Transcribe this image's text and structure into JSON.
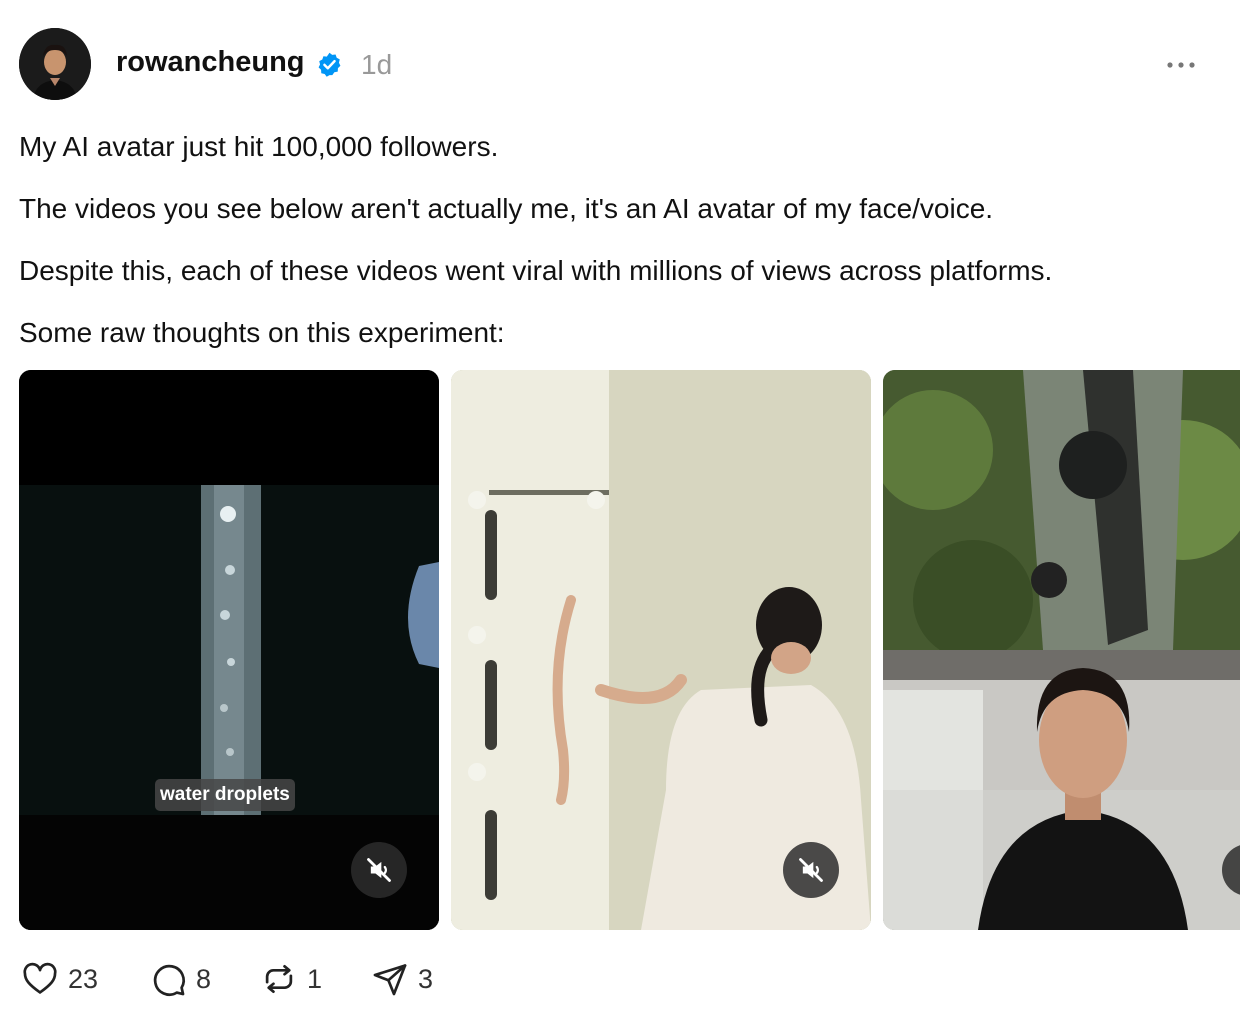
{
  "post": {
    "username": "rowancheung",
    "timestamp": "1d",
    "lines": [
      "My AI avatar just hit 100,000 followers.",
      "The videos you see below aren't actually me, it's an AI avatar of my face/voice.",
      "Despite this, each of these videos went viral with millions of views across platforms.",
      "Some raw thoughts on this experiment:"
    ]
  },
  "media": {
    "caption": "water droplets"
  },
  "actions": {
    "likes": "23",
    "replies": "8",
    "reposts": "1",
    "shares": "3"
  },
  "icons": {
    "verified": "verified-badge-icon",
    "more": "more-horizontal-icon",
    "mute": "speaker-muted-icon",
    "like": "heart-icon",
    "reply": "comment-bubble-icon",
    "repost": "repost-arrows-icon",
    "share": "paper-plane-icon"
  },
  "colors": {
    "verified": "#0095F6",
    "muted_text": "#999999"
  }
}
